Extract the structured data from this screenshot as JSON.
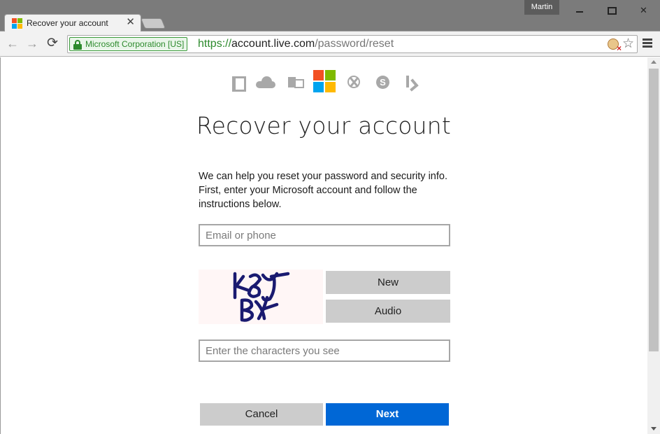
{
  "browser": {
    "tab_title": "Recover your account",
    "tab_close": "✕",
    "profile_name": "Martin",
    "window_close": "✕",
    "nav_back": "←",
    "nav_forward": "→",
    "nav_reload": "⟳",
    "ev_label": "Microsoft Corporation [US]",
    "url_scheme": "https://",
    "url_host": "account.live.com",
    "url_path": "/password/reset",
    "bookmark_star": "☆"
  },
  "page": {
    "title": "Recover your account",
    "intro": "We can help you reset your password and security info. First, enter your Microsoft account and follow the instructions below.",
    "email_placeholder": "Email or phone",
    "captcha_text": "K8Y BX",
    "new_label": "New",
    "audio_label": "Audio",
    "captcha_placeholder": "Enter the characters you see",
    "cancel_label": "Cancel",
    "next_label": "Next"
  },
  "icons": {
    "products": [
      "office-icon",
      "onedrive-icon",
      "outlook-icon",
      "microsoft-logo",
      "xbox-icon",
      "skype-icon",
      "bing-icon"
    ],
    "skype_letter": "S"
  },
  "colors": {
    "ms_red": "#f25022",
    "ms_green": "#7fba00",
    "ms_blue": "#00a4ef",
    "ms_yellow": "#ffb900",
    "primary_button": "#0067d6",
    "ev_green": "#2c8a2c"
  }
}
